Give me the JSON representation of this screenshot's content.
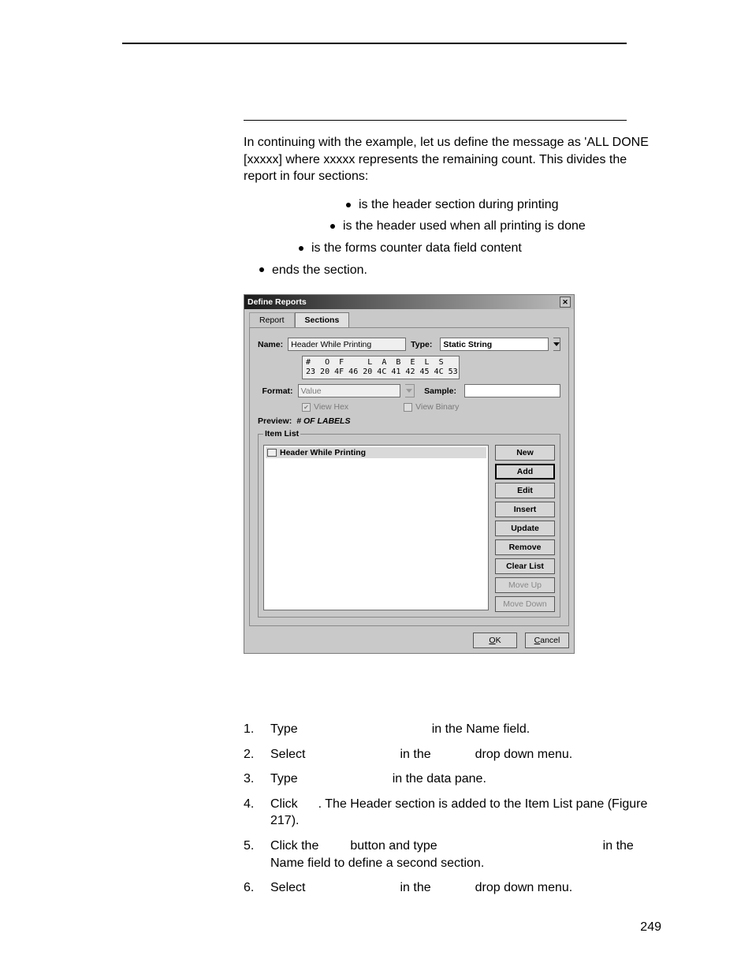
{
  "intro": "In continuing with the example, let us define the message as 'ALL DONE [xxxxx] where xxxxx represents the remaining count. This divides the report in four sections:",
  "section_bullets": [
    "is the header section during printing",
    "is the header used when all printing is done",
    "is the forms counter data field content",
    "ends the section."
  ],
  "dialog": {
    "title": "Define Reports",
    "close_glyph": "✕",
    "tabs": {
      "report": "Report",
      "sections": "Sections"
    },
    "labels": {
      "name": "Name:",
      "type": "Type:",
      "format": "Format:",
      "sample": "Sample:",
      "preview": "Preview:",
      "itemlist": "Item List"
    },
    "fields": {
      "name_value": "Header While Printing",
      "type_value": "Static String",
      "format_value": "Value",
      "sample_value": ""
    },
    "hex_line1": "#   O  F     L  A  B  E  L  S",
    "hex_line2": "23 20 4F 46 20 4C 41 42 45 4C 53",
    "view_hex": "View Hex",
    "view_binary": "View Binary",
    "preview_value": "# OF LABELS",
    "list_item": "Header While Printing",
    "buttons": {
      "new": "New",
      "add": "Add",
      "edit": "Edit",
      "insert": "Insert",
      "update": "Update",
      "remove": "Remove",
      "clear": "Clear List",
      "moveup": "Move Up",
      "movedown": "Move Down",
      "ok": "K",
      "ok_u": "O",
      "cancel": "ancel",
      "cancel_u": "C"
    }
  },
  "steps": {
    "s1a": "Type",
    "s1b": "in the Name field.",
    "s2a": "Select",
    "s2b": "in the",
    "s2c": "drop down menu.",
    "s3a": "Type",
    "s3b": "in the data pane.",
    "s4a": "Click",
    "s4b": ". The Header section is added to the Item List pane (Figure 217).",
    "s5a": "Click the",
    "s5b": "button and type",
    "s5c": "in the Name field to define a second section.",
    "s6a": "Select",
    "s6b": "in the",
    "s6c": "drop down menu."
  },
  "page_number": "249"
}
